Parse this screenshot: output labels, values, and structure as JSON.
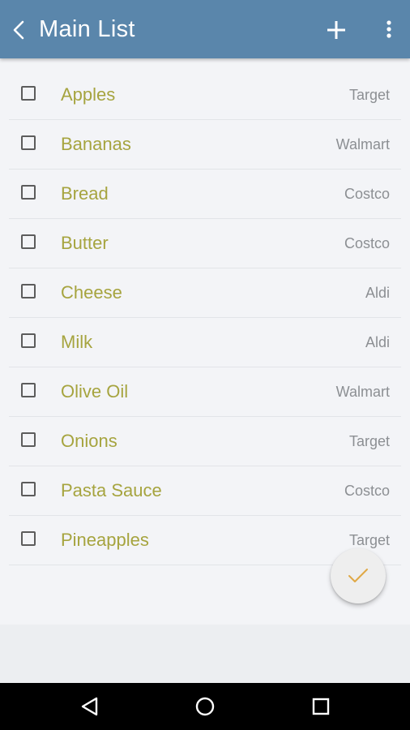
{
  "appbar": {
    "title": "Main List",
    "back_icon": "chevron-left-icon",
    "add_icon": "plus-icon",
    "more_icon": "more-vert-icon",
    "color": "#5a86ab"
  },
  "items": [
    {
      "name": "Apples",
      "store": "Target",
      "checked": false
    },
    {
      "name": "Bananas",
      "store": "Walmart",
      "checked": false
    },
    {
      "name": "Bread",
      "store": "Costco",
      "checked": false
    },
    {
      "name": "Butter",
      "store": "Costco",
      "checked": false
    },
    {
      "name": "Cheese",
      "store": "Aldi",
      "checked": false
    },
    {
      "name": "Milk",
      "store": "Aldi",
      "checked": false
    },
    {
      "name": "Olive Oil",
      "store": "Walmart",
      "checked": false
    },
    {
      "name": "Onions",
      "store": "Target",
      "checked": false
    },
    {
      "name": "Pasta Sauce",
      "store": "Costco",
      "checked": false
    },
    {
      "name": "Pineapples",
      "store": "Target",
      "checked": false
    }
  ],
  "fab": {
    "icon": "checkmark-icon",
    "accent": "#e0a845"
  },
  "colors": {
    "item_text": "#a6a43f",
    "store_text": "#8c8f93"
  },
  "navbar": {
    "icons": [
      "back-triangle-icon",
      "home-circle-icon",
      "recents-square-icon"
    ]
  }
}
